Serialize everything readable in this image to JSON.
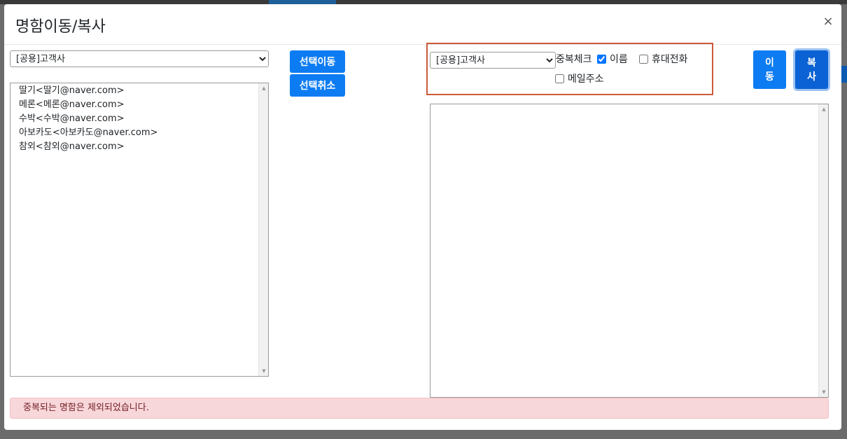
{
  "modal": {
    "title": "명함이동/복사",
    "close_label": "×"
  },
  "source": {
    "group_options": [
      "[공용]고객사"
    ],
    "selected_group": "[공용]고객사",
    "items": [
      {
        "label": "딸기<딸기@naver.com>"
      },
      {
        "label": "메론<메론@naver.com>"
      },
      {
        "label": "수박<수박@naver.com>"
      },
      {
        "label": "아보카도<아보카도@naver.com>"
      },
      {
        "label": "참외<참외@naver.com>"
      }
    ]
  },
  "actions": {
    "move_selected_label": "선택이동",
    "cancel_selected_label": "선택취소"
  },
  "target": {
    "group_options": [
      "[공용]고객사"
    ],
    "selected_group": "[공용]고객사",
    "items": []
  },
  "dup_check": {
    "label": "중복체크",
    "options": [
      {
        "label": "이름",
        "checked": true
      },
      {
        "label": "휴대전화",
        "checked": false
      },
      {
        "label": "메일주소",
        "checked": false
      }
    ]
  },
  "buttons": {
    "move_label_1": "이",
    "move_label_2": "동",
    "copy_label_1": "복",
    "copy_label_2": "사"
  },
  "alert": {
    "message": "중복되는 명함은 제외되었습니다."
  },
  "colors": {
    "primary": "#0d7cf2",
    "highlight_border": "#cc5a3a",
    "alert_bg": "#f8d7da"
  }
}
